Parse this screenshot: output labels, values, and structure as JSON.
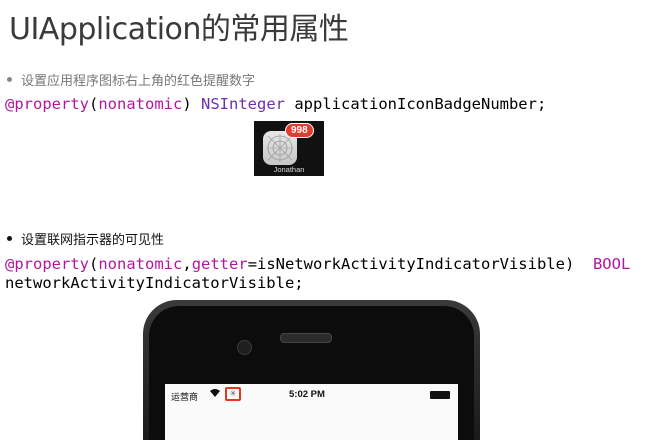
{
  "title": "UIApplication的常用属性",
  "bullets": [
    "设置应用程序图标右上角的红色提醒数字",
    "设置联网指示器的可见性"
  ],
  "code1": {
    "at_property": "@property",
    "open": "(",
    "attr": "nonatomic",
    "close": ") ",
    "type": "NSInteger",
    "name": " applicationIconBadgeNumber;"
  },
  "code2": {
    "at_property": "@property",
    "open": "(",
    "attr1": "nonatomic",
    "comma": ",",
    "attr2": "getter",
    "getter_value": "=isNetworkActivityIndicatorVisible)  ",
    "type": "BOOL",
    "line2": "networkActivityIndicatorVisible;"
  },
  "app_icon": {
    "badge": "998",
    "name": "Jonathan"
  },
  "phone_status": {
    "carrier": "运营商",
    "wifi": "wifi-icon",
    "activity": "activity-indicator-icon",
    "time": "5:02 PM",
    "battery": "battery-icon"
  },
  "colors": {
    "keyword": "#b4169f",
    "type": "#6f2fae",
    "badge": "#e53b2f",
    "highlight": "#e0381f"
  }
}
